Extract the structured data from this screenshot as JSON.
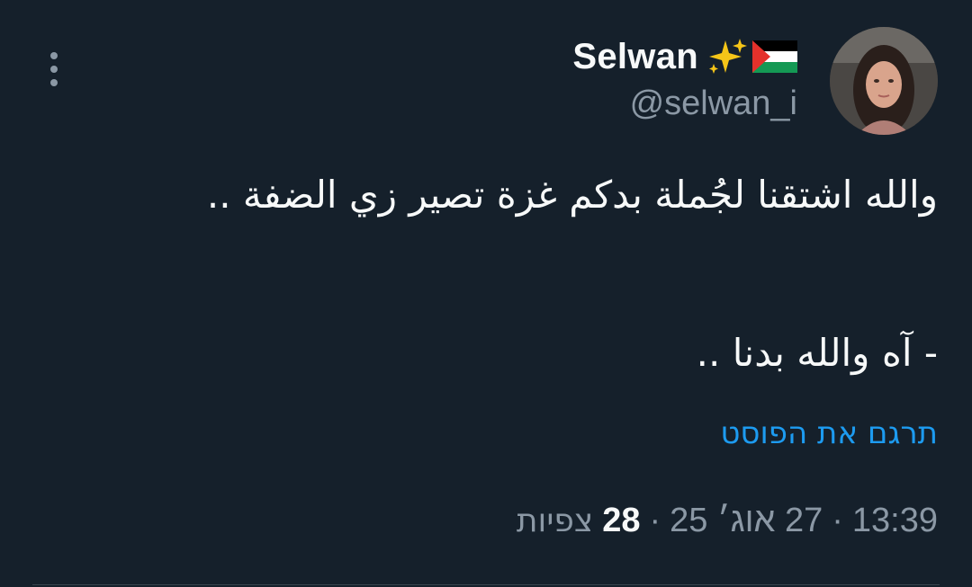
{
  "author": {
    "display_name": "Selwan",
    "handle": "@selwan_i",
    "name_emojis": [
      "sparkles-emoji",
      "palestine-flag-emoji"
    ]
  },
  "tweet": {
    "line1": "والله اشتقنا لجُملة بدكم غزة تصير زي الضفة ..",
    "line2": "- آه والله بدنا .."
  },
  "translate_label": "תרגם את הפוסט",
  "meta": {
    "time": "13:39",
    "date": "27 אוג׳ 25",
    "views_count": "28",
    "views_label": "צפיות",
    "separator": "·"
  },
  "icons": {
    "more": "more-vertical-icon"
  },
  "colors": {
    "background": "#15202b",
    "text": "#f7f9f9",
    "secondary": "#8b98a5",
    "link": "#1d9bf0"
  }
}
